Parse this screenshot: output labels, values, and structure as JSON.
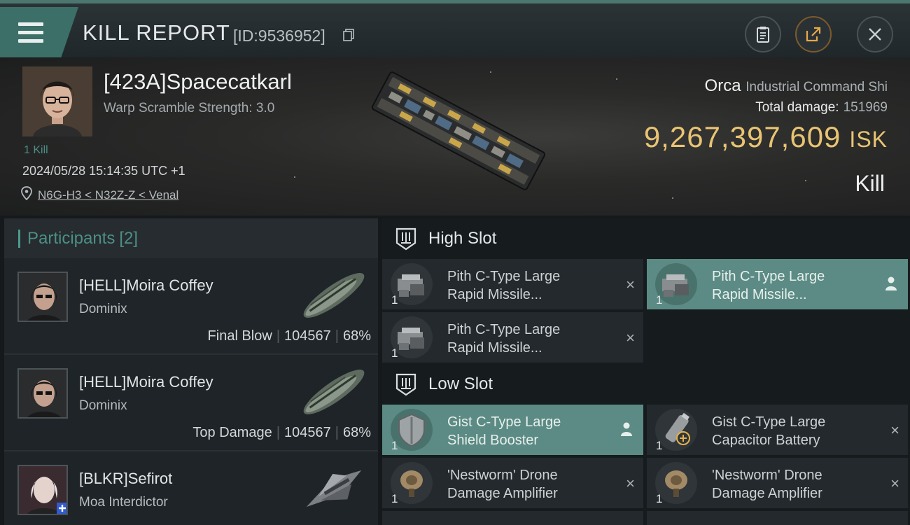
{
  "header": {
    "title": "KILL REPORT",
    "report_id": "[ID:9536952]"
  },
  "victim": {
    "name": "[423A]Spacecatkarl",
    "warp_scramble": "Warp Scramble Strength: 3.0",
    "kills": "1 Kill",
    "datetime": "2024/05/28 15:14:35 UTC +1",
    "location": "N6G-H3 < N32Z-Z < Venal",
    "ship_name": "Orca",
    "ship_class": "Industrial Command Shi",
    "total_damage_label": "Total damage:",
    "total_damage": "151969",
    "isk_value": "9,267,397,609",
    "isk_unit": "ISK",
    "result": "Kill"
  },
  "participants": {
    "title": "Participants",
    "count": "[2]",
    "rows": [
      {
        "name": "[HELL]Moira Coffey",
        "ship": "Dominix",
        "role": "Final Blow",
        "damage": "104567",
        "percent": "68%"
      },
      {
        "name": "[HELL]Moira Coffey",
        "ship": "Dominix",
        "role": "Top Damage",
        "damage": "104567",
        "percent": "68%"
      },
      {
        "name": "[BLKR]Sefirot",
        "ship": "Moa Interdictor"
      }
    ]
  },
  "slots": {
    "high": {
      "title": "High Slot",
      "modules": [
        {
          "line1": "Pith C-Type Large",
          "line2": "Rapid Missile...",
          "qty": "1",
          "mark": "×"
        },
        {
          "line1": "Pith C-Type Large",
          "line2": "Rapid Missile...",
          "qty": "1"
        },
        {
          "line1": "Pith C-Type Large",
          "line2": "Rapid Missile...",
          "qty": "1",
          "mark": "×"
        }
      ]
    },
    "low": {
      "title": "Low Slot",
      "modules": [
        {
          "line1": "Gist C-Type Large",
          "line2": "Shield Booster",
          "qty": "1"
        },
        {
          "line1": "Gist C-Type Large",
          "line2": "Capacitor Battery",
          "qty": "1",
          "mark": "×"
        },
        {
          "line1": "'Nestworm' Drone",
          "line2": "Damage Amplifier",
          "qty": "1",
          "mark": "×"
        },
        {
          "line1": "'Nestworm' Drone",
          "line2": "Damage Amplifier",
          "qty": "1",
          "mark": "×"
        }
      ]
    }
  },
  "colors": {
    "accent": "#4d8f85",
    "highlight": "#5b8b84",
    "isk": "#e9c472"
  }
}
